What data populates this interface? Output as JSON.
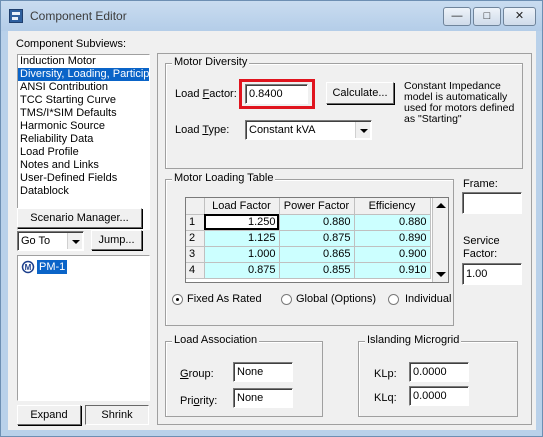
{
  "window": {
    "title": "Component Editor",
    "controls": {
      "minimize": "—",
      "maximize": "□",
      "close": "✕"
    }
  },
  "left": {
    "subviews_label": "Component Subviews:",
    "subviews": [
      "Induction Motor",
      "Diversity, Loading, Participation",
      "ANSI Contribution",
      "TCC Starting Curve",
      "TMS/I*SIM Defaults",
      "Harmonic Source",
      "Reliability Data",
      "Load Profile",
      "Notes and Links",
      "User-Defined Fields",
      "Datablock"
    ],
    "selected_subview": 1,
    "scenario_button": "Scenario Manager...",
    "goto_value": "Go To",
    "jump_button": "Jump...",
    "tree_item_label": "PM-1",
    "expand_button": "Expand",
    "shrink_button": "Shrink"
  },
  "motor_diversity": {
    "legend": "Motor Diversity",
    "load_factor_label_pre": "Load ",
    "load_factor_label_u": "F",
    "load_factor_label_post": "actor:",
    "load_factor_value": "0.8400",
    "calculate_button": "Calculate...",
    "note": [
      "Constant Impedance",
      "model is automatically",
      "used for motors defined",
      "as \"Starting\""
    ],
    "load_type_label_pre": "Load ",
    "load_type_label_u": "T",
    "load_type_label_post": "ype:",
    "load_type_value": "Constant kVA",
    "highlight_color": "#e0141e"
  },
  "loading_table": {
    "legend": "Motor Loading Table",
    "columns": [
      "Load Factor",
      "Power Factor",
      "Efficiency"
    ],
    "rows": [
      {
        "n": "1",
        "load_factor": "1.250",
        "power_factor": "0.880",
        "efficiency": "0.880"
      },
      {
        "n": "2",
        "load_factor": "1.125",
        "power_factor": "0.875",
        "efficiency": "0.890"
      },
      {
        "n": "3",
        "load_factor": "1.000",
        "power_factor": "0.865",
        "efficiency": "0.900"
      },
      {
        "n": "4",
        "load_factor": "0.875",
        "power_factor": "0.855",
        "efficiency": "0.910"
      }
    ],
    "cell_color": "#ccffff",
    "radios": [
      "Fixed As Rated",
      "Global (Options)",
      "Individual"
    ],
    "selected_radio": 0
  },
  "frame": {
    "label": "Frame:",
    "value": ""
  },
  "service_factor": {
    "label_1": "Service",
    "label_2": "Factor:",
    "value": "1.00"
  },
  "load_association": {
    "legend": "Load Association",
    "group_label_u": "G",
    "group_label_post": "roup:",
    "group_value": "None",
    "priority_label_pre": "Pri",
    "priority_label_u": "o",
    "priority_label_post": "rity:",
    "priority_value": "None"
  },
  "islanding": {
    "legend": "Islanding Microgrid",
    "klp_label": "KLp:",
    "klp_value": "0.0000",
    "klq_label": "KLq:",
    "klq_value": "0.0000"
  }
}
